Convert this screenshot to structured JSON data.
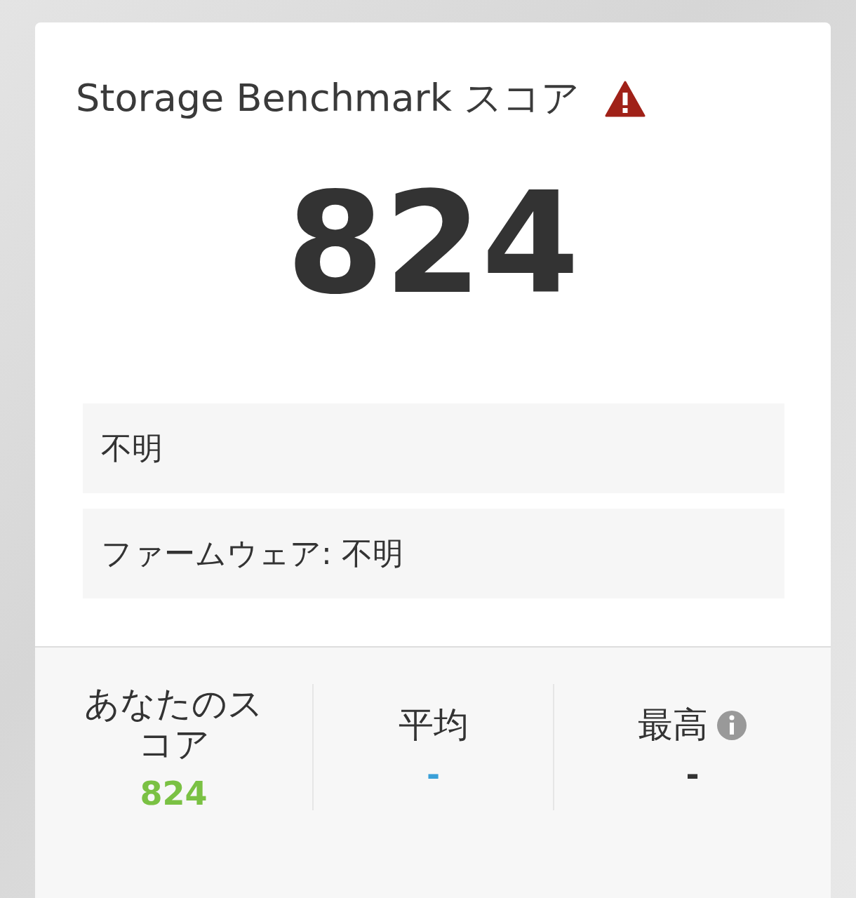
{
  "card": {
    "title": "Storage Benchmark スコア",
    "score": "824",
    "info_rows": [
      "不明",
      "ファームウェア: 不明"
    ],
    "stats": [
      {
        "label": "あなたのスコア",
        "value": "824",
        "color": "#7ac143",
        "has_info": false
      },
      {
        "label": "平均",
        "value": "-",
        "color": "#3aa0d8",
        "has_info": false
      },
      {
        "label": "最高",
        "value": "-",
        "color": "#333333",
        "has_info": true
      }
    ]
  }
}
